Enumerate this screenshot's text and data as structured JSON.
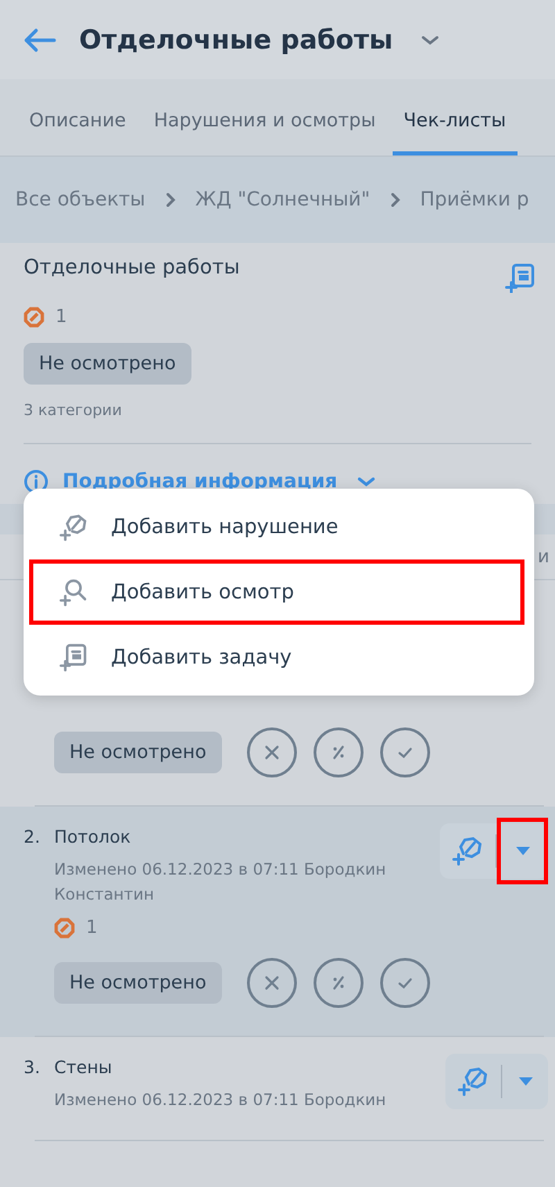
{
  "header": {
    "title": "Отделочные работы"
  },
  "tabs": [
    {
      "label": "Описание",
      "selected": false
    },
    {
      "label": "Нарушения и осмотры",
      "selected": false
    },
    {
      "label": "Чек-листы",
      "selected": true
    }
  ],
  "breadcrumbs": [
    "Все объекты",
    "ЖД \"Солнечный\"",
    "Приёмки р"
  ],
  "checklist": {
    "title": "Отделочные работы",
    "violations": "1",
    "status": "Не осмотрено",
    "categories": "3 категории",
    "details_link": "Подробная информация"
  },
  "column_tail": "и",
  "items": [
    {
      "status": "Не осмотрено",
      "selected": false
    },
    {
      "number": "2.",
      "title": "Потолок",
      "modified": "Изменено 06.12.2023 в 07:11 Бородкин Константин",
      "violations": "1",
      "status": "Не осмотрено",
      "selected": true,
      "caret_highlighted": true
    },
    {
      "number": "3.",
      "title": "Стены",
      "modified": "Изменено 06.12.2023 в 07:11 Бородкин",
      "selected": false,
      "caret_highlighted": false
    }
  ],
  "menu": [
    {
      "kind": "violation",
      "label": "Добавить нарушение",
      "highlighted": false
    },
    {
      "kind": "inspection",
      "label": "Добавить осмотр",
      "highlighted": true
    },
    {
      "kind": "task",
      "label": "Добавить задачу",
      "highlighted": false
    }
  ]
}
